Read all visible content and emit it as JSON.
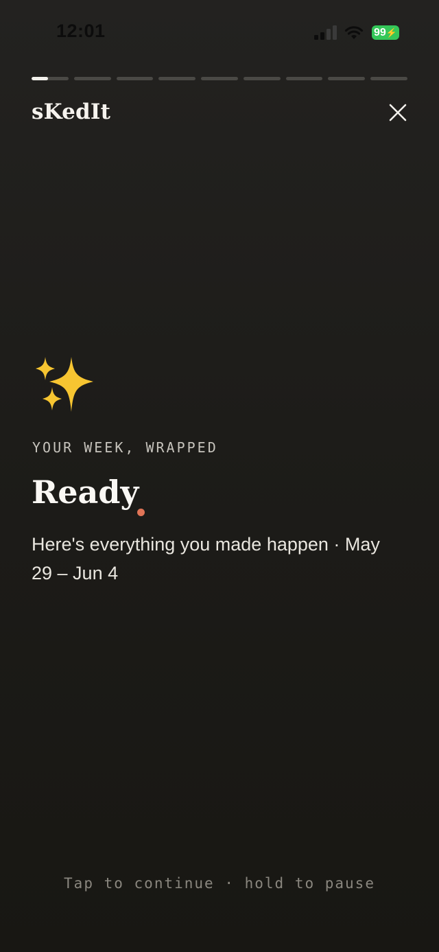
{
  "status_bar": {
    "time": "12:01",
    "battery_level": "99",
    "signal_icon": "cellular-signal-icon",
    "wifi_icon": "wifi-icon",
    "battery_color": "#34c759"
  },
  "story": {
    "segments_total": 9,
    "current_segment": 1,
    "current_segment_progress": 0.45
  },
  "header": {
    "brand": "sKedIt",
    "close_icon": "close-icon"
  },
  "content": {
    "emoji_icon": "sparkles-icon",
    "eyebrow": "YOUR WEEK, WRAPPED",
    "headline": "Ready",
    "subtitle": "Here's everything you made happen · May 29 – Jun 4",
    "accent_color": "#e07456"
  },
  "footer": {
    "hint": "Tap to continue · hold to pause"
  }
}
